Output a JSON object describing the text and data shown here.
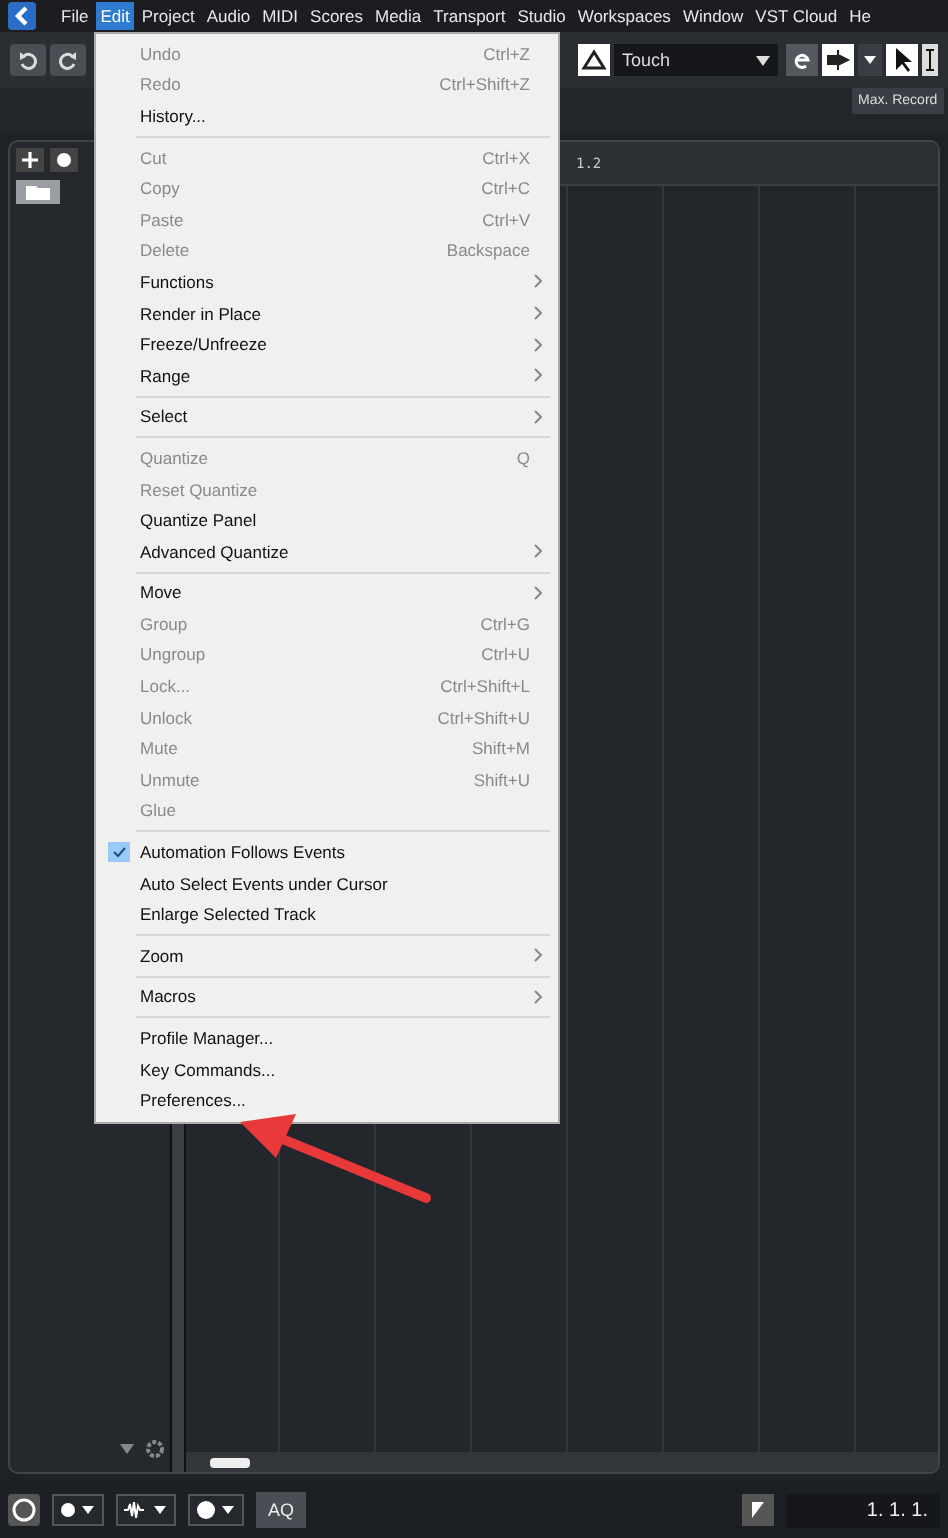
{
  "app_menu": [
    {
      "label": "File",
      "selected": false
    },
    {
      "label": "Edit",
      "selected": true
    },
    {
      "label": "Project",
      "selected": false
    },
    {
      "label": "Audio",
      "selected": false
    },
    {
      "label": "MIDI",
      "selected": false
    },
    {
      "label": "Scores",
      "selected": false
    },
    {
      "label": "Media",
      "selected": false
    },
    {
      "label": "Transport",
      "selected": false
    },
    {
      "label": "Studio",
      "selected": false
    },
    {
      "label": "Workspaces",
      "selected": false
    },
    {
      "label": "Window",
      "selected": false
    },
    {
      "label": "VST Cloud",
      "selected": false
    },
    {
      "label": "He",
      "selected": false
    }
  ],
  "toolbar": {
    "automation_mode": "Touch"
  },
  "tooltip": "Max. Record",
  "ruler": {
    "marker": "1.2"
  },
  "edit_menu": [
    {
      "kind": "item",
      "label": "Undo",
      "shortcut": "Ctrl+Z",
      "disabled": true,
      "checked": false,
      "submenu": false
    },
    {
      "kind": "item",
      "label": "Redo",
      "shortcut": "Ctrl+Shift+Z",
      "disabled": true,
      "checked": false,
      "submenu": false
    },
    {
      "kind": "item",
      "label": "History...",
      "disabled": false,
      "checked": false,
      "submenu": false
    },
    {
      "kind": "separator"
    },
    {
      "kind": "item",
      "label": "Cut",
      "shortcut": "Ctrl+X",
      "disabled": true,
      "checked": false,
      "submenu": false
    },
    {
      "kind": "item",
      "label": "Copy",
      "shortcut": "Ctrl+C",
      "disabled": true,
      "checked": false,
      "submenu": false
    },
    {
      "kind": "item",
      "label": "Paste",
      "shortcut": "Ctrl+V",
      "disabled": true,
      "checked": false,
      "submenu": false
    },
    {
      "kind": "item",
      "label": "Delete",
      "shortcut": "Backspace",
      "disabled": true,
      "checked": false,
      "submenu": false
    },
    {
      "kind": "item",
      "label": "Functions",
      "disabled": false,
      "checked": false,
      "submenu": true
    },
    {
      "kind": "item",
      "label": "Render in Place",
      "disabled": false,
      "checked": false,
      "submenu": true
    },
    {
      "kind": "item",
      "label": "Freeze/Unfreeze",
      "disabled": false,
      "checked": false,
      "submenu": true
    },
    {
      "kind": "item",
      "label": "Range",
      "disabled": false,
      "checked": false,
      "submenu": true
    },
    {
      "kind": "separator"
    },
    {
      "kind": "item",
      "label": "Select",
      "disabled": false,
      "checked": false,
      "submenu": true
    },
    {
      "kind": "separator"
    },
    {
      "kind": "item",
      "label": "Quantize",
      "shortcut": "Q",
      "disabled": true,
      "checked": false,
      "submenu": false
    },
    {
      "kind": "item",
      "label": "Reset Quantize",
      "disabled": true,
      "checked": false,
      "submenu": false
    },
    {
      "kind": "item",
      "label": "Quantize Panel",
      "disabled": false,
      "checked": false,
      "submenu": false
    },
    {
      "kind": "item",
      "label": "Advanced Quantize",
      "disabled": false,
      "checked": false,
      "submenu": true
    },
    {
      "kind": "separator"
    },
    {
      "kind": "item",
      "label": "Move",
      "disabled": false,
      "checked": false,
      "submenu": true
    },
    {
      "kind": "item",
      "label": "Group",
      "shortcut": "Ctrl+G",
      "disabled": true,
      "checked": false,
      "submenu": false
    },
    {
      "kind": "item",
      "label": "Ungroup",
      "shortcut": "Ctrl+U",
      "disabled": true,
      "checked": false,
      "submenu": false
    },
    {
      "kind": "item",
      "label": "Lock...",
      "shortcut": "Ctrl+Shift+L",
      "disabled": true,
      "checked": false,
      "submenu": false
    },
    {
      "kind": "item",
      "label": "Unlock",
      "shortcut": "Ctrl+Shift+U",
      "disabled": true,
      "checked": false,
      "submenu": false
    },
    {
      "kind": "item",
      "label": "Mute",
      "shortcut": "Shift+M",
      "disabled": true,
      "checked": false,
      "submenu": false
    },
    {
      "kind": "item",
      "label": "Unmute",
      "shortcut": "Shift+U",
      "disabled": true,
      "checked": false,
      "submenu": false
    },
    {
      "kind": "item",
      "label": "Glue",
      "disabled": true,
      "checked": false,
      "submenu": false
    },
    {
      "kind": "separator"
    },
    {
      "kind": "item",
      "label": "Automation Follows Events",
      "disabled": false,
      "checked": true,
      "submenu": false
    },
    {
      "kind": "item",
      "label": "Auto Select Events under Cursor",
      "disabled": false,
      "checked": false,
      "submenu": false
    },
    {
      "kind": "item",
      "label": "Enlarge Selected Track",
      "disabled": false,
      "checked": false,
      "submenu": false
    },
    {
      "kind": "separator"
    },
    {
      "kind": "item",
      "label": "Zoom",
      "disabled": false,
      "checked": false,
      "submenu": true
    },
    {
      "kind": "separator"
    },
    {
      "kind": "item",
      "label": "Macros",
      "disabled": false,
      "checked": false,
      "submenu": true
    },
    {
      "kind": "separator"
    },
    {
      "kind": "item",
      "label": "Profile Manager...",
      "disabled": false,
      "checked": false,
      "submenu": false
    },
    {
      "kind": "item",
      "label": "Key Commands...",
      "disabled": false,
      "checked": false,
      "submenu": false
    },
    {
      "kind": "item",
      "label": "Preferences...",
      "disabled": false,
      "checked": false,
      "submenu": false
    }
  ],
  "bottom_bar": {
    "quantize_button": "AQ",
    "position": "1. 1. 1."
  }
}
